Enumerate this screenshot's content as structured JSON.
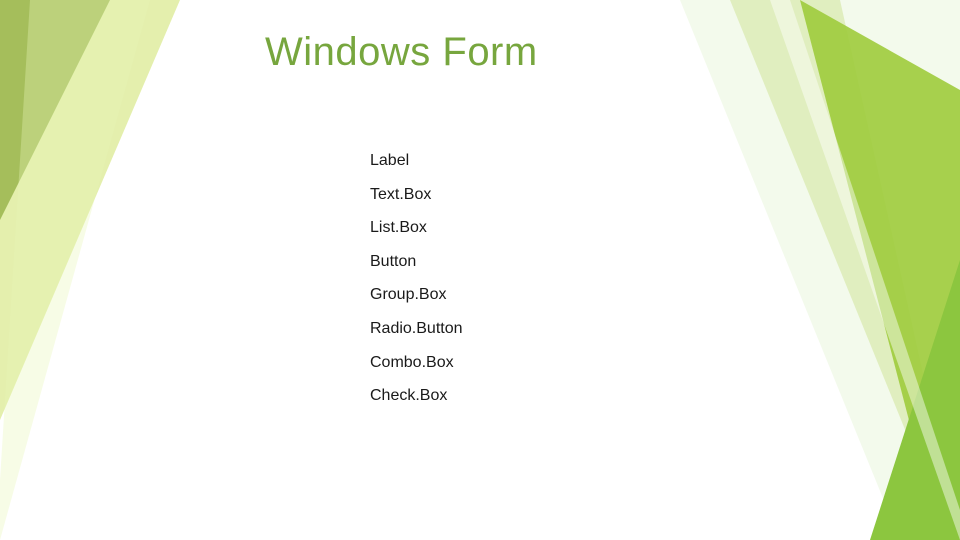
{
  "title": "Windows Form",
  "items": [
    "Label",
    "Text.Box",
    "List.Box",
    "Button",
    "Group.Box",
    "Radio.Button",
    "Combo.Box",
    "Check.Box"
  ]
}
